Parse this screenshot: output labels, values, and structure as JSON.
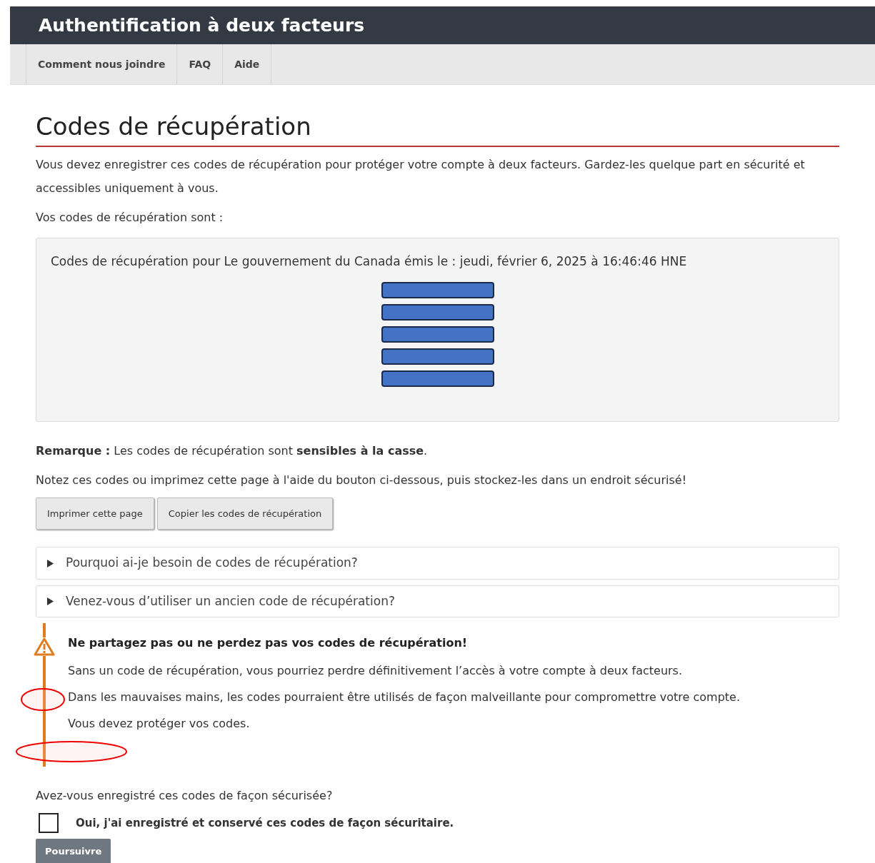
{
  "header": {
    "title": "Authentification à deux facteurs"
  },
  "nav": [
    {
      "label": "Comment nous joindre"
    },
    {
      "label": "FAQ"
    },
    {
      "label": "Aide"
    }
  ],
  "page_title": "Codes de récupération",
  "intro": "Vous devez enregistrer ces codes de récupération pour protéger votre compte à deux facteurs. Gardez-les quelque part en sécurité et accessibles uniquement à vous.",
  "codes_label": "Vos codes de récupération sont :",
  "codes_box": {
    "heading": "Codes de récupération pour Le gouvernement du Canada émis le : jeudi, février 6, 2025 à 16:46:46 HNE",
    "codes": [
      {
        "kind": "redacted"
      },
      {
        "kind": "redacted"
      },
      {
        "kind": "redacted"
      },
      {
        "kind": "redacted"
      },
      {
        "kind": "redacted"
      }
    ]
  },
  "note": "**Remarque :** Les codes de récupération sont **sensibles à la casse**.",
  "instructions": "Notez ces codes ou imprimez cette page à l'aide du bouton ci-dessous, puis stockez-les dans un endroit sécurisé!",
  "buttons": [
    {
      "label": "Imprimer cette page"
    },
    {
      "label": "Copier les codes de récupération"
    }
  ],
  "details": [
    {
      "summary": "Pourquoi ai-je besoin de codes de récupération?",
      "expanded": false
    },
    {
      "summary": "Venez-vous d’utiliser un ancien code de récupération?",
      "expanded": false
    }
  ],
  "warning": {
    "title": "Ne partagez pas ou ne perdez pas vos codes de récupération!",
    "lines": [
      "Sans un code de récupération, vous pourriez perdre définitivement l’accès à votre compte à deux facteurs.",
      "Dans les mauvaises mains, les codes pourraient être utilisés de façon malveillante pour compromettre votre compte.",
      "Vous devez protéger vos codes."
    ]
  },
  "question": "Avez-vous enregistré ces codes de façon sécurisée?",
  "confirm": {
    "label": "Oui, j'ai enregistré et conservé ces codes de façon sécuritaire.",
    "checked": false
  },
  "submit": {
    "label": "Poursuivre",
    "disabled": true
  }
}
